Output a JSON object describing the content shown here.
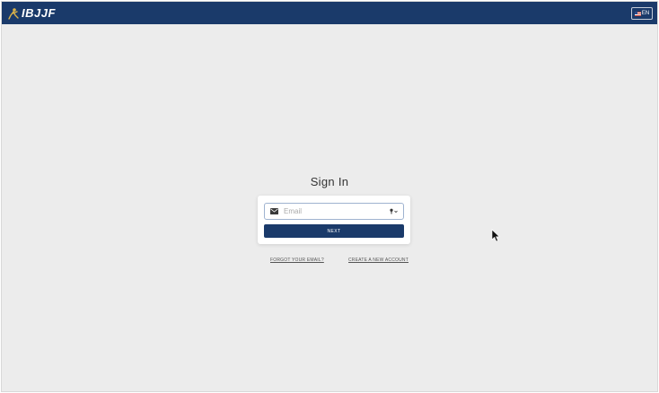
{
  "header": {
    "brand": "IBJJF",
    "language_label": "EN",
    "background_color": "#1a3a6a"
  },
  "signin": {
    "title": "Sign In",
    "email_placeholder": "Email",
    "email_value": "",
    "next_label": "NEXT",
    "button_color": "#1a3a6a"
  },
  "links": {
    "forgot_email": "FORGOT YOUR EMAIL?",
    "create_account": "CREATE A NEW ACCOUNT"
  },
  "icons": {
    "logo": "fighter-logo-icon",
    "flag": "us-flag-icon",
    "email": "envelope-icon",
    "password_manager": "key-icon",
    "cursor": "mouse-pointer-icon"
  }
}
